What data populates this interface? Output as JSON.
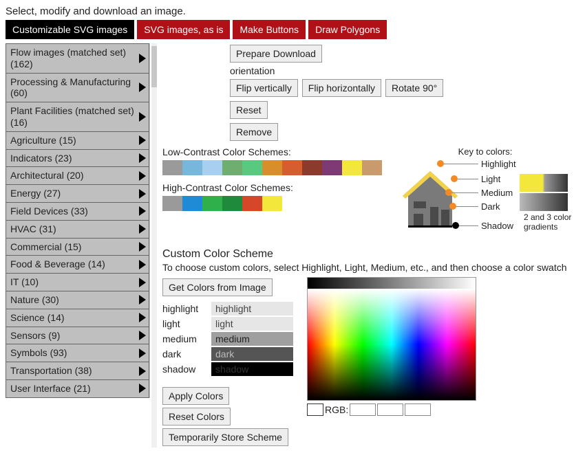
{
  "intro": "Select, modify and download an image.",
  "tabs": [
    {
      "label": "Customizable SVG images",
      "active": true
    },
    {
      "label": "SVG images, as is",
      "active": false
    },
    {
      "label": "Make Buttons",
      "active": false
    },
    {
      "label": "Draw Polygons",
      "active": false
    }
  ],
  "sidebar": {
    "items": [
      {
        "label": "Flow images (matched set) (162)"
      },
      {
        "label": "Processing & Manufacturing (60)"
      },
      {
        "label": "Plant Facilities (matched set) (16)"
      },
      {
        "label": "Agriculture (15)"
      },
      {
        "label": "Indicators (23)"
      },
      {
        "label": "Architectural (20)"
      },
      {
        "label": "Energy (27)"
      },
      {
        "label": "Field Devices (33)"
      },
      {
        "label": "HVAC (31)"
      },
      {
        "label": "Commercial (15)"
      },
      {
        "label": "Food & Beverage (14)"
      },
      {
        "label": "IT (10)"
      },
      {
        "label": "Nature (30)"
      },
      {
        "label": "Science (14)"
      },
      {
        "label": "Sensors (9)"
      },
      {
        "label": "Symbols (93)"
      },
      {
        "label": "Transportation (38)"
      },
      {
        "label": "User Interface (21)"
      }
    ]
  },
  "buttons": {
    "prepare_download": "Prepare Download",
    "flip_v": "Flip vertically",
    "flip_h": "Flip horizontally",
    "rotate": "Rotate 90°",
    "reset": "Reset",
    "remove": "Remove",
    "get_colors": "Get Colors from Image",
    "apply_colors": "Apply Colors",
    "reset_colors": "Reset Colors",
    "temp_store": "Temporarily Store Scheme"
  },
  "labels": {
    "orientation": "orientation",
    "low_contrast": "Low-Contrast Color Schemes:",
    "high_contrast": "High-Contrast Color Schemes:",
    "custom_heading": "Custom Color Scheme",
    "custom_desc": "To choose custom colors, select Highlight, Light, Medium, etc., and then choose a color swatch",
    "key_title": "Key to colors:",
    "key_highlight": "Highlight",
    "key_light": "Light",
    "key_medium": "Medium",
    "key_dark": "Dark",
    "key_shadow": "Shadow",
    "key_gradients": "2 and 3 color gradients",
    "rgb": "RGB:"
  },
  "hilo": {
    "rows": [
      {
        "label": "highlight",
        "value": "highlight",
        "cls": "hl"
      },
      {
        "label": "light",
        "value": "light",
        "cls": "lt"
      },
      {
        "label": "medium",
        "value": "medium",
        "cls": "md"
      },
      {
        "label": "dark",
        "value": "dark",
        "cls": "dk"
      },
      {
        "label": "shadow",
        "value": "shadow",
        "cls": "sh"
      }
    ]
  },
  "low_swatches": [
    "#9a9a9a",
    "#76b7db",
    "#a7cff0",
    "#6fae6f",
    "#58c97f",
    "#d88f2b",
    "#d55d2e",
    "#8b3a2c",
    "#7e3a74",
    "#f4e73b",
    "#c99a6b"
  ],
  "high_swatches": [
    "#9a9a9a",
    "#1f8ad6",
    "#2fb04a",
    "#1f8a3b",
    "#d6472a",
    "#f4e73b"
  ]
}
